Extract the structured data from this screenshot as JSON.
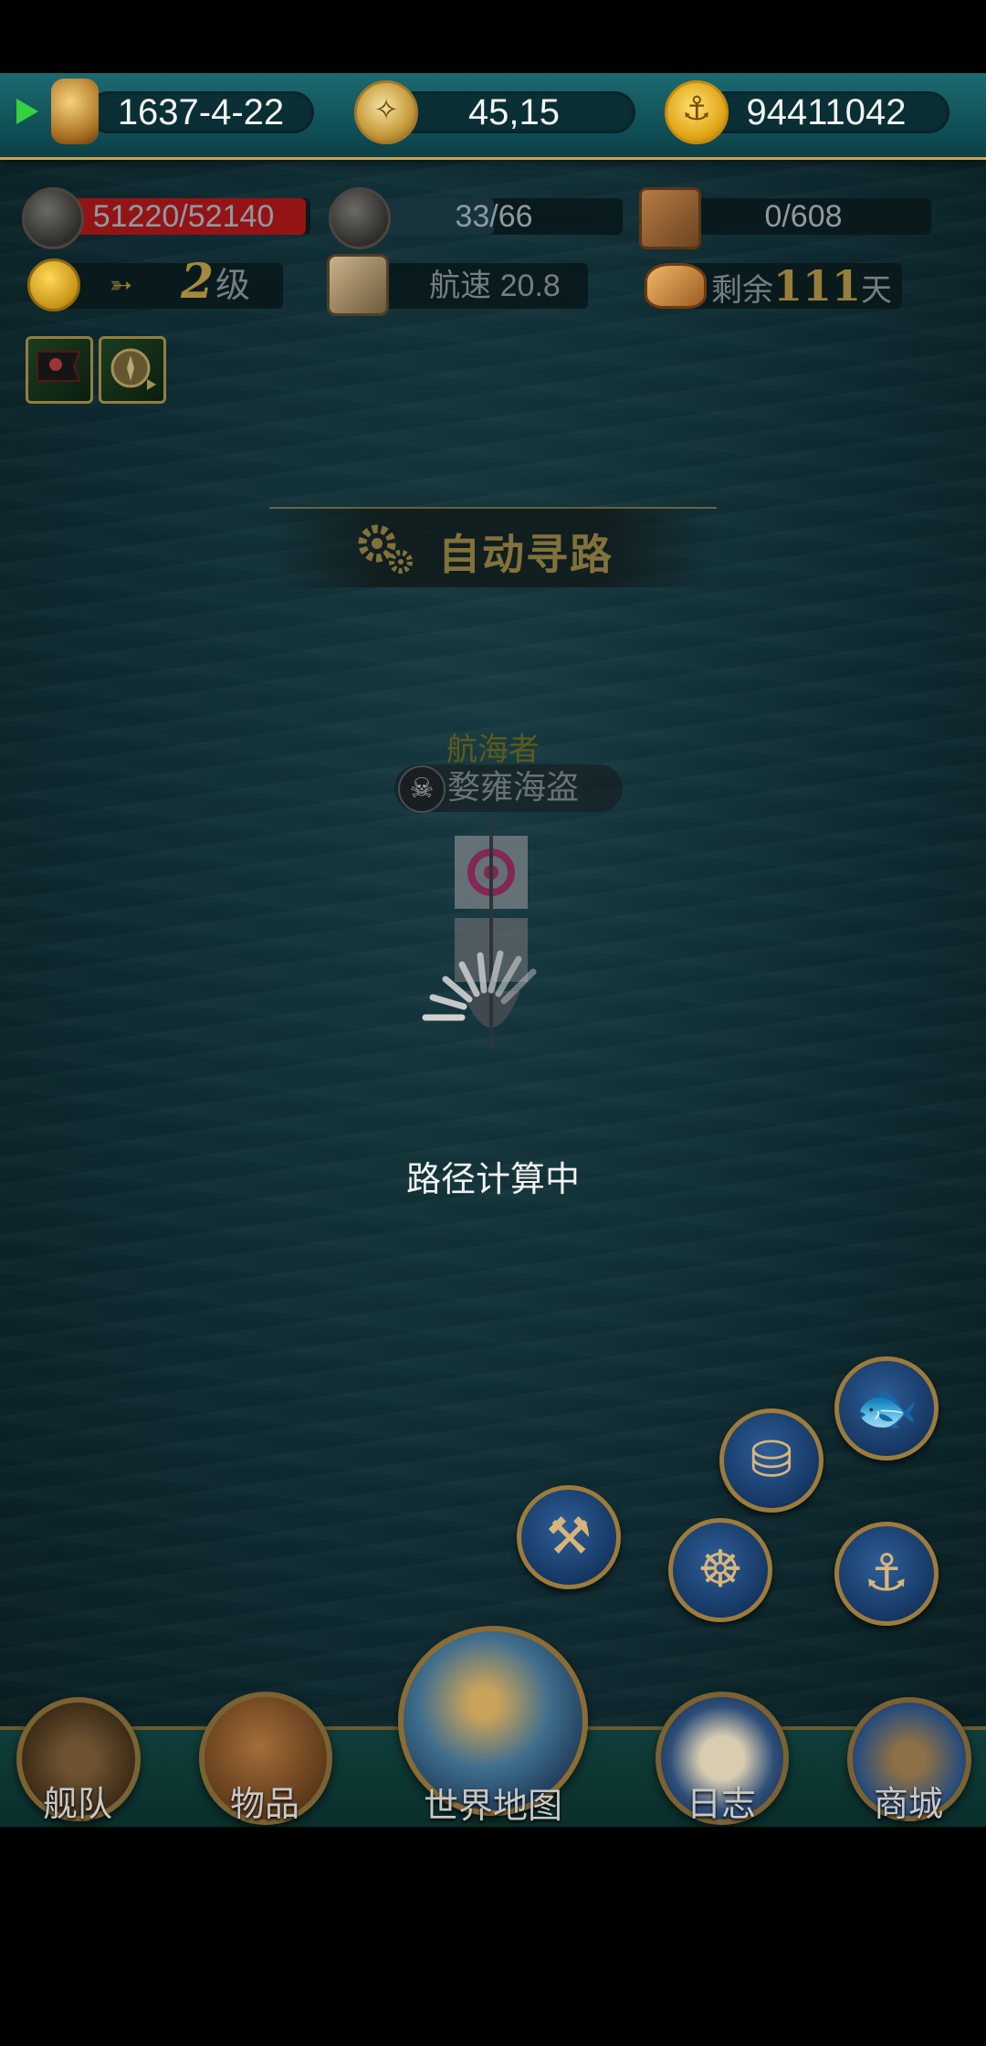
{
  "topbar": {
    "date": "1637-4-22",
    "coords": "45,15",
    "gold": "94411042"
  },
  "stats": {
    "durability": {
      "text": "51220/52140",
      "current": 51220,
      "max": 52140,
      "color": "#b5191b"
    },
    "sailors": {
      "text": "33/66",
      "current": 33,
      "max": 66
    },
    "cargo": {
      "text": "0/608",
      "current": 0,
      "max": 608
    },
    "level_num": "2",
    "level_unit": "级",
    "speed_label": "航速",
    "speed_value": "20.8",
    "days_prefix": "剩余",
    "days_num": "111",
    "days_suffix": "天"
  },
  "buffs": [
    "pirate-flag-icon",
    "compass-speed-icon"
  ],
  "auto_path": {
    "label": "自动寻路"
  },
  "ship": {
    "name": "航海者",
    "guild": "婺雍海盗"
  },
  "loading": {
    "text": "路径计算中"
  },
  "actions": [
    "fish-icon",
    "barrel-icon",
    "hammer-icon",
    "ship-wheel-rope-icon",
    "anchor-icon"
  ],
  "nav": {
    "fleet": "舰队",
    "items": "物品",
    "world_map": "世界地图",
    "log": "日志",
    "shop": "商城"
  }
}
